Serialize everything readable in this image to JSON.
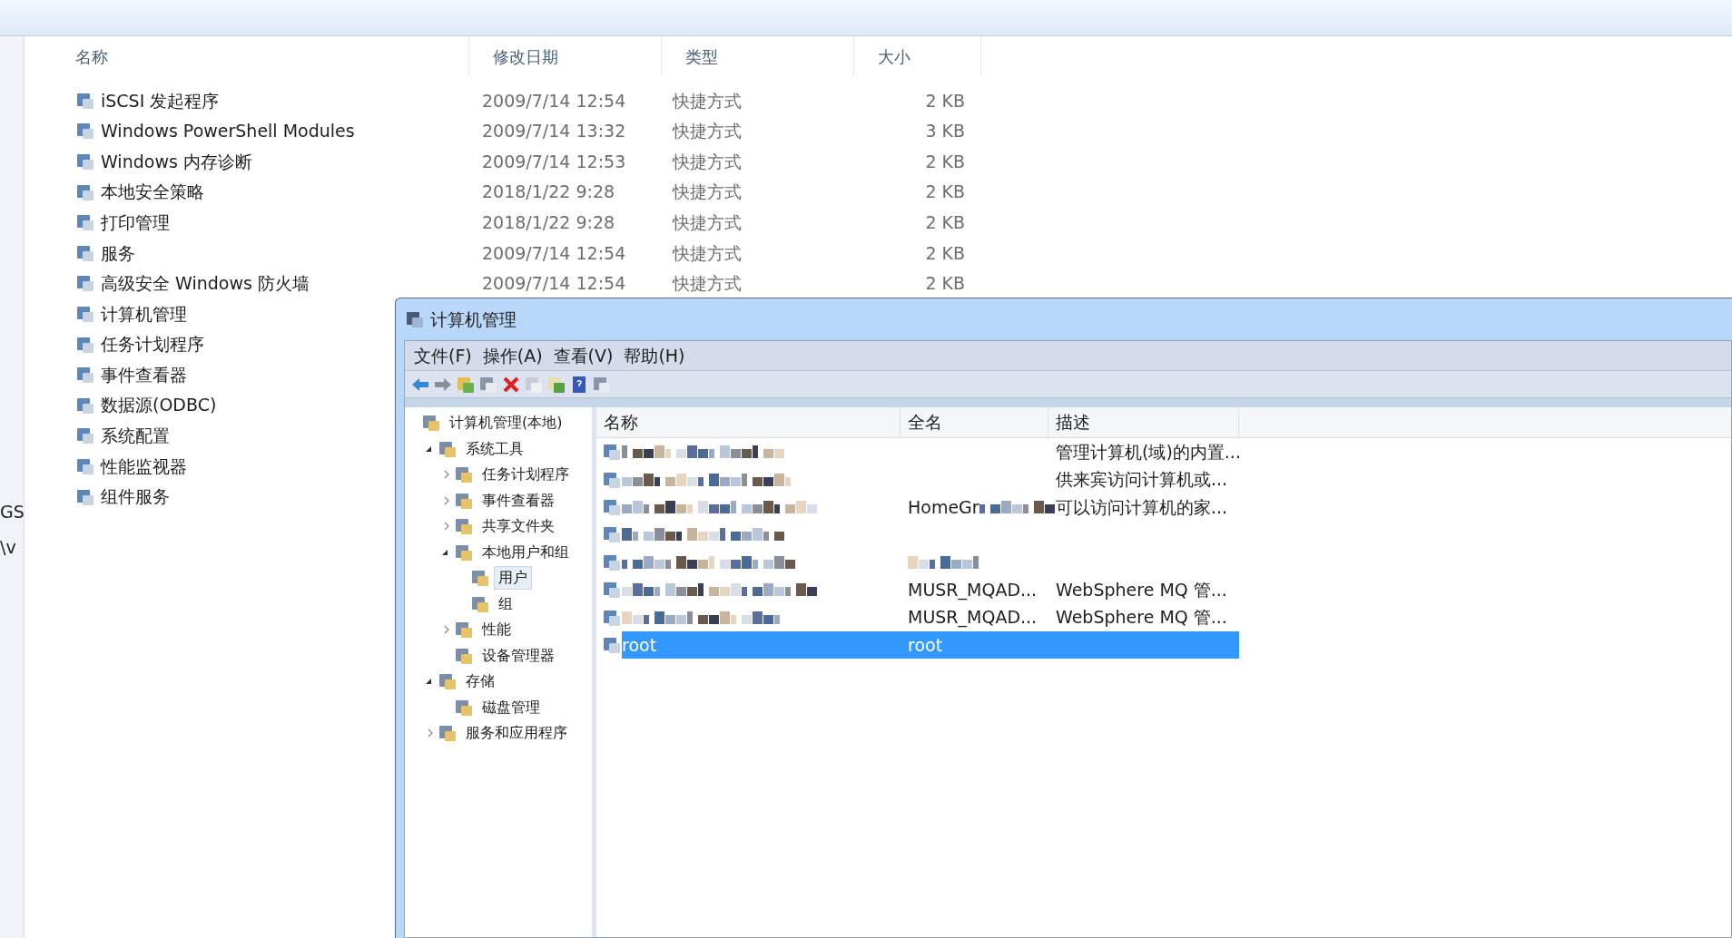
{
  "explorer": {
    "columns": [
      "名称",
      "修改日期",
      "类型",
      "大小"
    ],
    "rows": [
      {
        "name": "iSCSI 发起程序",
        "date": "2009/7/14 12:54",
        "type": "快捷方式",
        "size": "2 KB"
      },
      {
        "name": "Windows PowerShell Modules",
        "date": "2009/7/14 13:32",
        "type": "快捷方式",
        "size": "3 KB"
      },
      {
        "name": "Windows 内存诊断",
        "date": "2009/7/14 12:53",
        "type": "快捷方式",
        "size": "2 KB"
      },
      {
        "name": "本地安全策略",
        "date": "2018/1/22 9:28",
        "type": "快捷方式",
        "size": "2 KB"
      },
      {
        "name": "打印管理",
        "date": "2018/1/22 9:28",
        "type": "快捷方式",
        "size": "2 KB"
      },
      {
        "name": "服务",
        "date": "2009/7/14 12:54",
        "type": "快捷方式",
        "size": "2 KB"
      },
      {
        "name": "高级安全 Windows 防火墙",
        "date": "2009/7/14 12:54",
        "type": "快捷方式",
        "size": "2 KB"
      },
      {
        "name": "计算机管理"
      },
      {
        "name": "任务计划程序"
      },
      {
        "name": "事件查看器"
      },
      {
        "name": "数据源(ODBC)"
      },
      {
        "name": "系统配置"
      },
      {
        "name": "性能监视器"
      },
      {
        "name": "组件服务"
      }
    ],
    "left_edge_texts": [
      "GS",
      "\\v"
    ]
  },
  "window": {
    "title": "计算机管理",
    "menu": [
      "文件(F)",
      "操作(A)",
      "查看(V)",
      "帮助(H)"
    ],
    "tree": [
      {
        "label": "计算机管理(本地)",
        "children": [
          {
            "label": "系统工具",
            "expanded": true,
            "children": [
              {
                "label": "任务计划程序",
                "expanded": false
              },
              {
                "label": "事件查看器",
                "expanded": false
              },
              {
                "label": "共享文件夹",
                "expanded": false
              },
              {
                "label": "本地用户和组",
                "expanded": true,
                "children": [
                  {
                    "label": "用户",
                    "selected": true
                  },
                  {
                    "label": "组",
                    "selected": false
                  }
                ]
              },
              {
                "label": "性能",
                "expanded": false
              },
              {
                "label": "设备管理器"
              }
            ]
          },
          {
            "label": "存储",
            "expanded": true,
            "children": [
              {
                "label": "磁盘管理"
              }
            ]
          },
          {
            "label": "服务和应用程序",
            "expanded": false
          }
        ]
      }
    ],
    "list": {
      "columns": [
        "名称",
        "全名",
        "描述"
      ],
      "rows": [
        {
          "name_redacted": true,
          "description": "管理计算机(域)的内置...",
          "selected": false
        },
        {
          "name_redacted": true,
          "description": "供来宾访问计算机或...",
          "selected": false
        },
        {
          "name_redacted": true,
          "full_name": "HomeGr",
          "full_name_redacted": true,
          "description": "可以访问计算机的家...",
          "selected": false
        },
        {
          "name_redacted": true,
          "selected": false
        },
        {
          "name_redacted": true,
          "full_name_redacted": true,
          "selected": false
        },
        {
          "name_redacted": true,
          "full_name": "MUSR_MQAD...",
          "description": "WebSphere MQ 管...",
          "selected": false
        },
        {
          "name_redacted": true,
          "full_name": "MUSR_MQAD...",
          "description": "WebSphere MQ 管...",
          "selected": false
        },
        {
          "name": "root",
          "full_name": "root",
          "selected": true
        }
      ]
    }
  }
}
